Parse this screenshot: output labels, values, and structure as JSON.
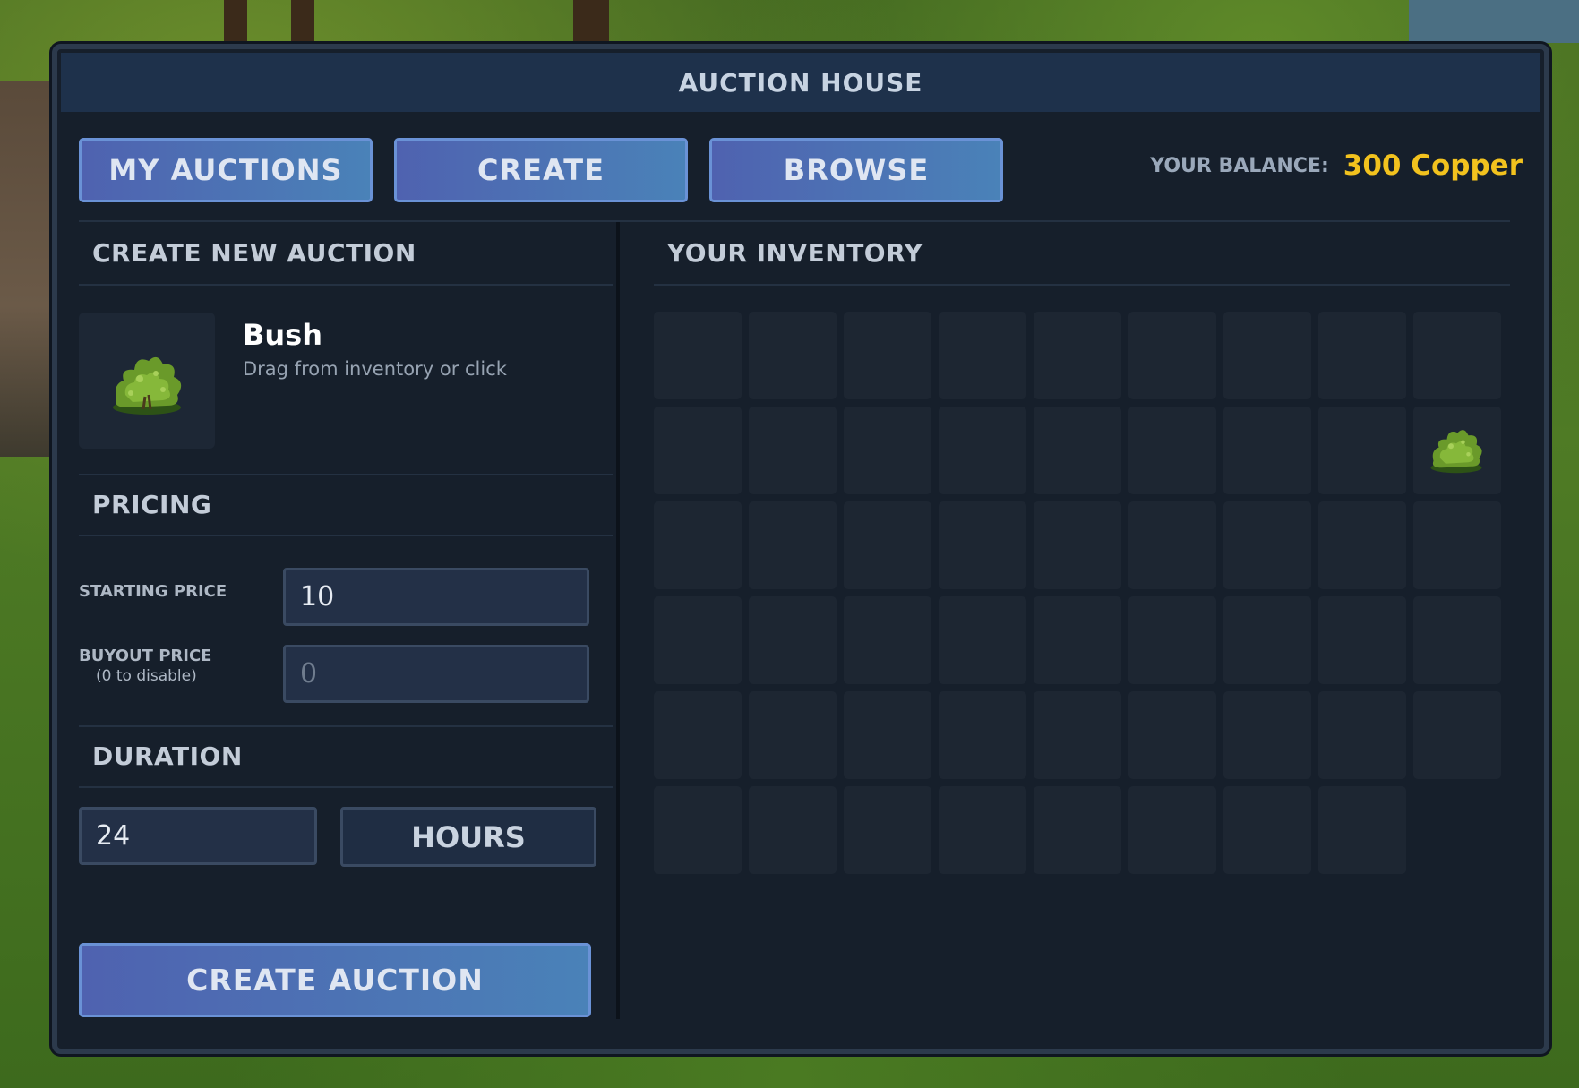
{
  "window": {
    "title": "AUCTION HOUSE"
  },
  "tabs": [
    {
      "label": "MY AUCTIONS"
    },
    {
      "label": "CREATE"
    },
    {
      "label": "BROWSE"
    }
  ],
  "balance": {
    "label": "YOUR BALANCE:",
    "value": "300 Copper",
    "value_color": "#f2c21e"
  },
  "create_panel": {
    "title": "CREATE NEW AUCTION",
    "item": {
      "name": "Bush",
      "hint": "Drag from inventory or click",
      "icon": "bush-icon"
    },
    "pricing": {
      "title": "PRICING",
      "starting_label": "STARTING PRICE",
      "starting_value": "10",
      "buyout_label": "BUYOUT PRICE",
      "buyout_sub": "(0 to disable)",
      "buyout_placeholder": "0"
    },
    "duration": {
      "title": "DURATION",
      "value": "24",
      "unit": "HOURS"
    },
    "submit_label": "CREATE AUCTION"
  },
  "inventory": {
    "title": "YOUR INVENTORY",
    "columns": 9,
    "slot_count": 53,
    "filled": [
      {
        "slot": 17,
        "item": "bush-icon"
      }
    ]
  },
  "colors": {
    "accent": "#4a82b8",
    "panel": "#161f2b",
    "gold": "#f2c21e"
  }
}
